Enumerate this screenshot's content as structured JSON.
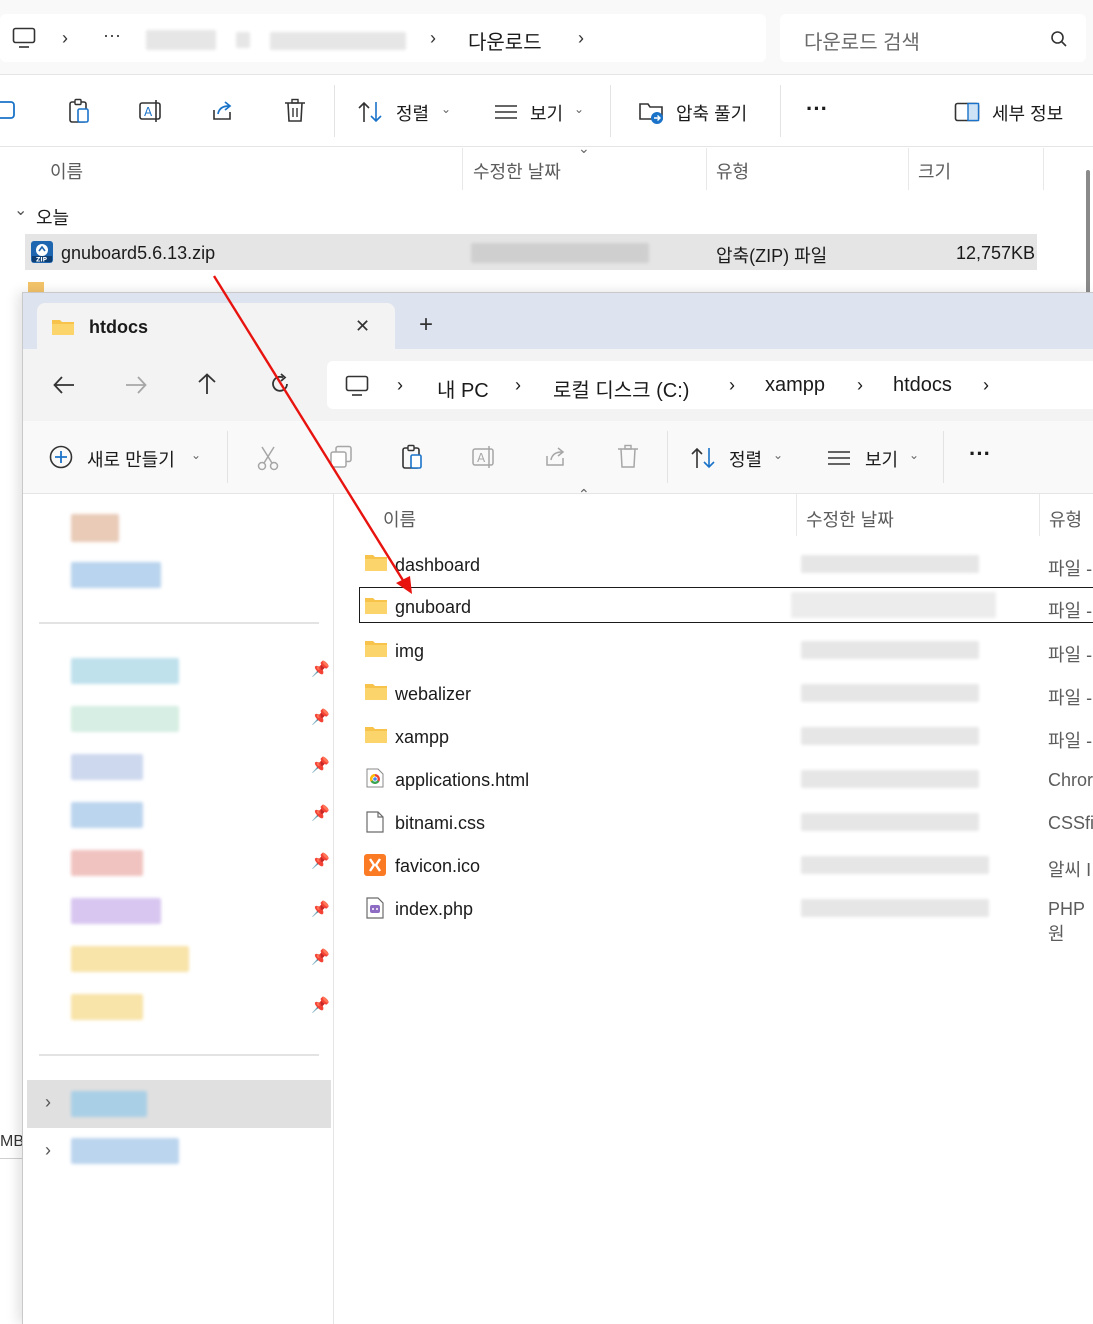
{
  "downloads_window": {
    "breadcrumb": {
      "ellipsis": "···",
      "current": "다운로드"
    },
    "search": {
      "placeholder": "다운로드 검색"
    },
    "toolbar": {
      "sort_label": "정렬",
      "view_label": "보기",
      "extract_label": "압축 풀기",
      "more_label": "···",
      "details_label": "세부 정보"
    },
    "columns": {
      "name": "이름",
      "modified": "수정한 날짜",
      "type": "유형",
      "size": "크기"
    },
    "group": {
      "label": "오늘"
    },
    "files": [
      {
        "name": "gnuboard5.6.13.zip",
        "type": "압축(ZIP) 파일",
        "size": "12,757KB",
        "icon": "zip-archive-icon"
      }
    ],
    "edge_text": "MB"
  },
  "htdocs_window": {
    "tab": {
      "title": "htdocs",
      "close": "✕",
      "new_tab": "+"
    },
    "path": [
      "내 PC",
      "로컬 디스크 (C:)",
      "xampp",
      "htdocs"
    ],
    "toolbar": {
      "new_label": "새로 만들기",
      "sort_label": "정렬",
      "view_label": "보기",
      "more_label": "···"
    },
    "columns": {
      "name": "이름",
      "modified": "수정한 날짜",
      "type": "유형"
    },
    "files": [
      {
        "name": "dashboard",
        "type": "파일 -",
        "icon": "folder-icon"
      },
      {
        "name": "gnuboard",
        "type": "파일 -",
        "icon": "folder-icon"
      },
      {
        "name": "img",
        "type": "파일 -",
        "icon": "folder-icon"
      },
      {
        "name": "webalizer",
        "type": "파일 -",
        "icon": "folder-icon"
      },
      {
        "name": "xampp",
        "type": "파일 -",
        "icon": "folder-icon"
      },
      {
        "name": "applications.html",
        "type": "Chror",
        "icon": "chrome-html-icon"
      },
      {
        "name": "bitnami.css",
        "type": "CSSfil",
        "icon": "blank-file-icon"
      },
      {
        "name": "favicon.ico",
        "type": "알씨 I",
        "icon": "xampp-ico-icon"
      },
      {
        "name": "index.php",
        "type": "PHP 원",
        "icon": "php-file-icon"
      }
    ]
  },
  "colors": {
    "drag_arrow": "#e8130f",
    "tab_strip": "#dde4f0",
    "selected_row": "#e5e5e5",
    "folder": "#f8c34a"
  }
}
